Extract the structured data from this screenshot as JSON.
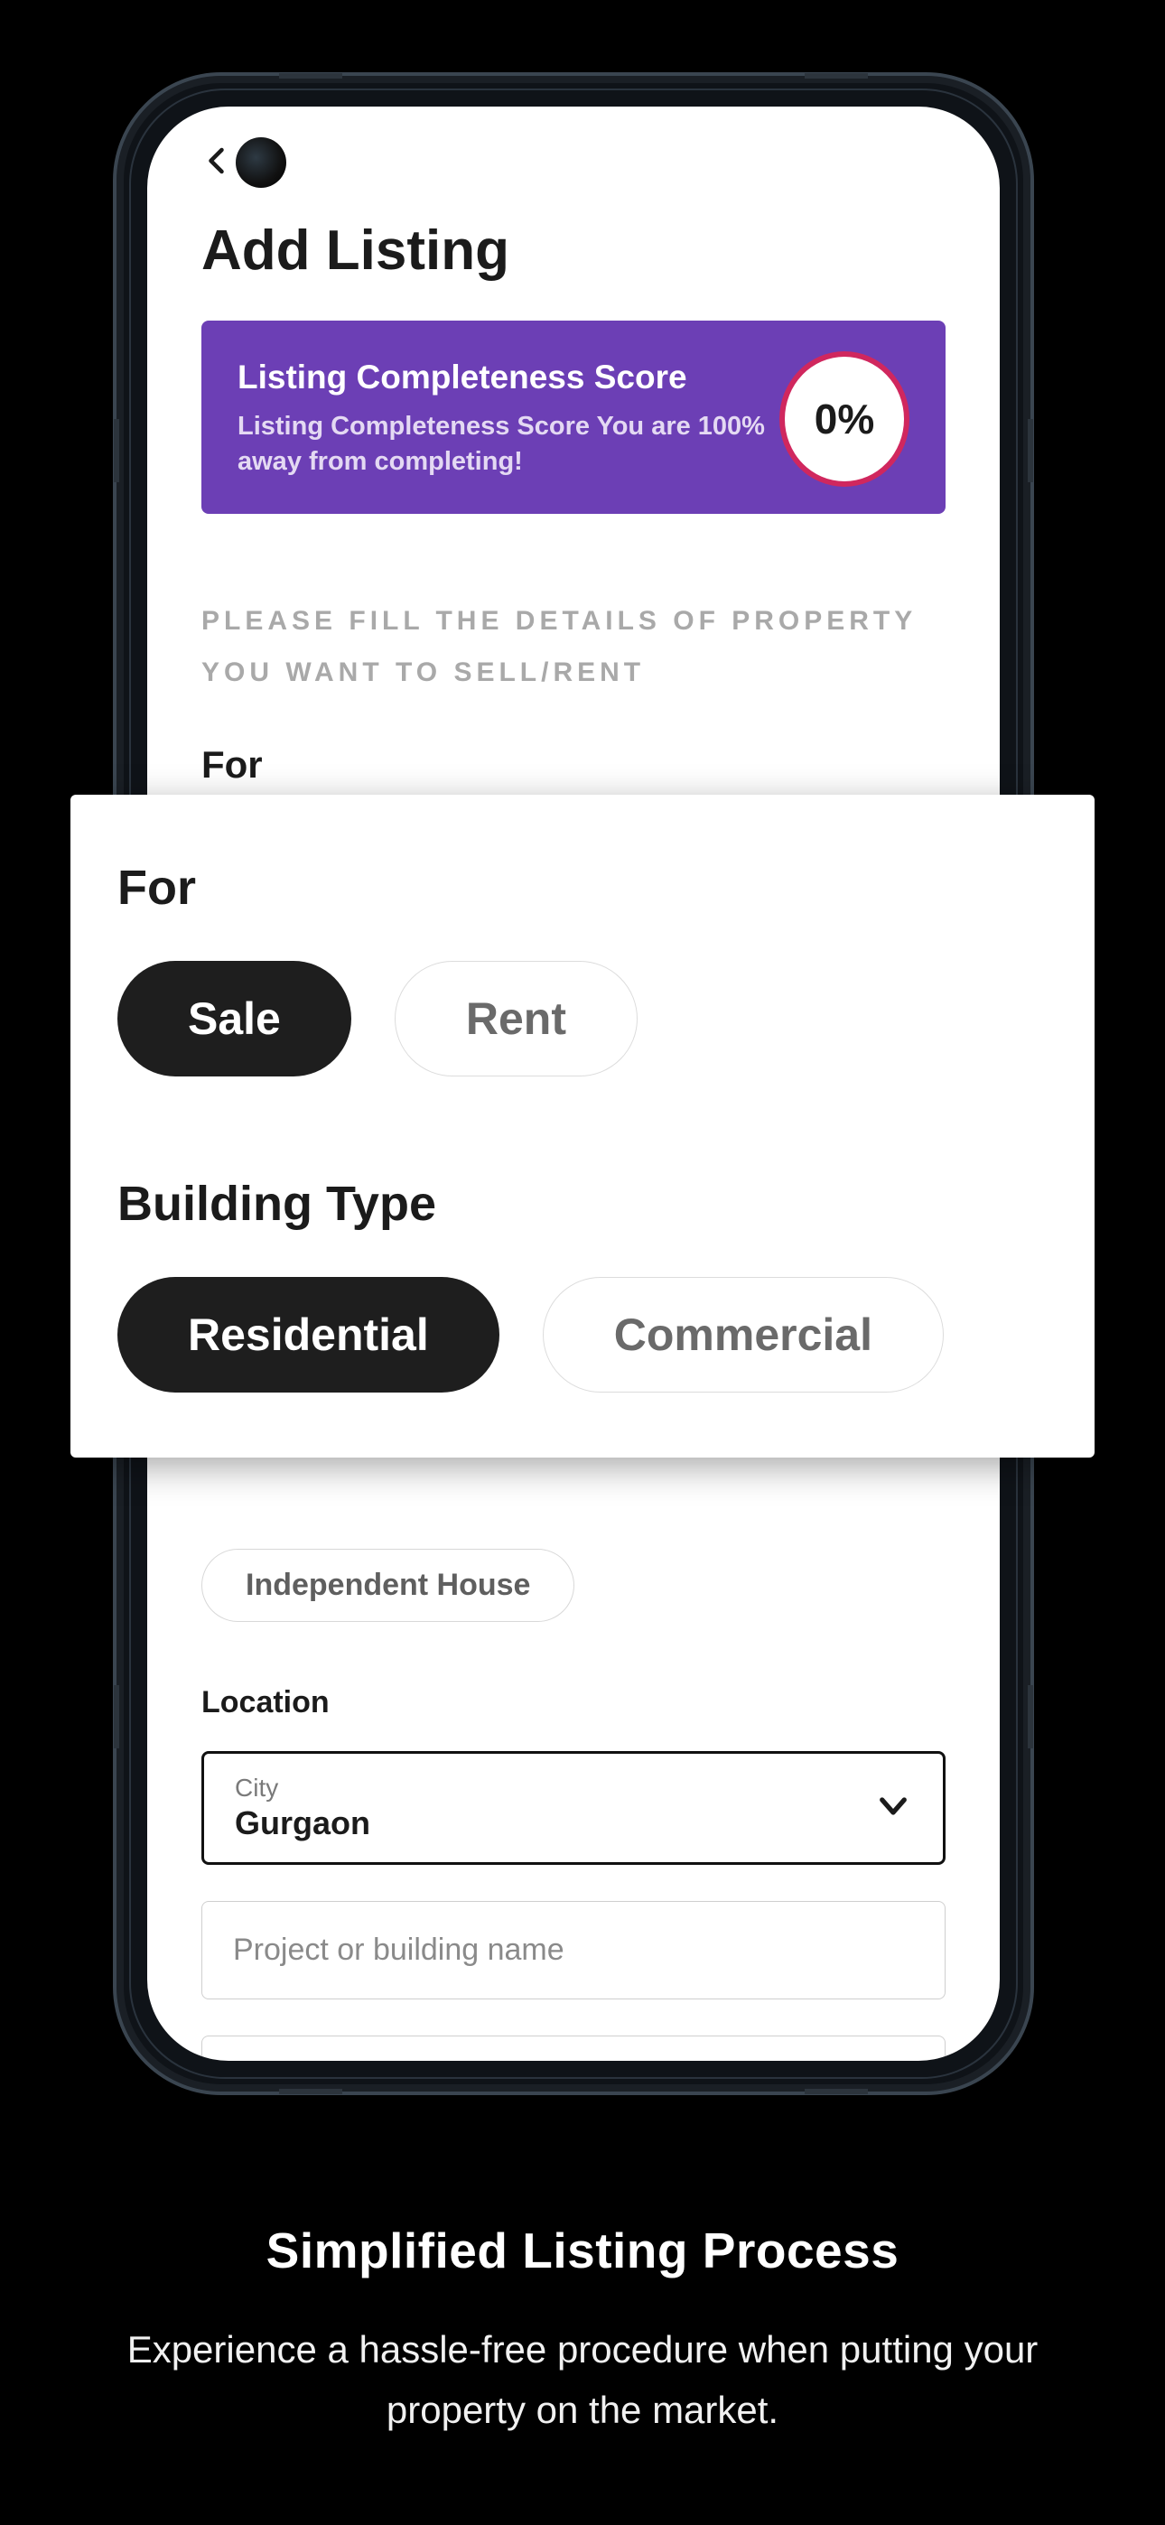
{
  "header": {
    "title": "Add Listing"
  },
  "score": {
    "title": "Listing Completeness Score",
    "subtitle": "Listing Completeness Score You are 100% away from completing!",
    "value": "0%"
  },
  "instruction": "PLEASE FILL THE DETAILS OF PROPERTY YOU WANT TO SELL/RENT",
  "peek_section_label": "For",
  "overlay": {
    "for": {
      "label": "For",
      "options": [
        "Sale",
        "Rent"
      ],
      "selected": "Sale"
    },
    "building_type": {
      "label": "Building Type",
      "options": [
        "Residential",
        "Commercial"
      ],
      "selected": "Residential"
    }
  },
  "visible_chip": "Independent House",
  "location": {
    "label": "Location",
    "city_caption": "City",
    "city_value": "Gurgaon",
    "project_placeholder": "Project or building name"
  },
  "promo": {
    "title": "Simplified Listing Process",
    "subtitle": "Experience a hassle-free procedure when putting your property on the market."
  }
}
